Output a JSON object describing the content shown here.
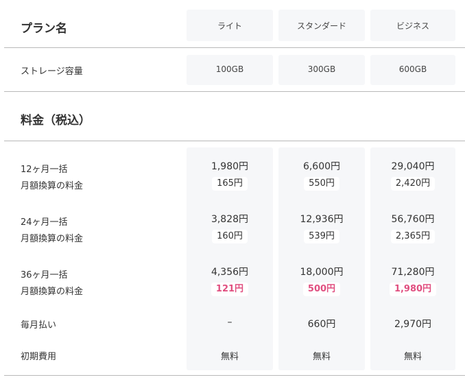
{
  "plan_header": {
    "label": "プラン名",
    "plans": [
      "ライト",
      "スタンダード",
      "ビジネス"
    ]
  },
  "storage": {
    "label": "ストレージ容量",
    "values": [
      "100GB",
      "300GB",
      "600GB"
    ]
  },
  "price_section": {
    "label": "料金（税込）"
  },
  "rows": [
    {
      "label": "12ヶ月一括",
      "sub_label": "月額換算の料金",
      "totals": [
        "1,980円",
        "6,600円",
        "29,040円"
      ],
      "monthly": [
        "165円",
        "550円",
        "2,420円"
      ]
    },
    {
      "label": "24ヶ月一括",
      "sub_label": "月額換算の料金",
      "totals": [
        "3,828円",
        "12,936円",
        "56,760円"
      ],
      "monthly": [
        "160円",
        "539円",
        "2,365円"
      ]
    },
    {
      "label": "36ヶ月一括",
      "sub_label": "月額換算の料金",
      "totals": [
        "4,356円",
        "18,000円",
        "71,280円"
      ],
      "monthly": [
        "121円",
        "500円",
        "1,980円"
      ]
    }
  ],
  "monthly_pay": {
    "label": "毎月払い",
    "values": [
      "–",
      "660円",
      "2,970円"
    ]
  },
  "initial_fee": {
    "label": "初期費用",
    "values": [
      "無料",
      "無料",
      "無料"
    ]
  },
  "colors": {
    "highlight": "#e04f80",
    "column_bg": "#f6f7f9",
    "divider": "#b9b9b9"
  }
}
